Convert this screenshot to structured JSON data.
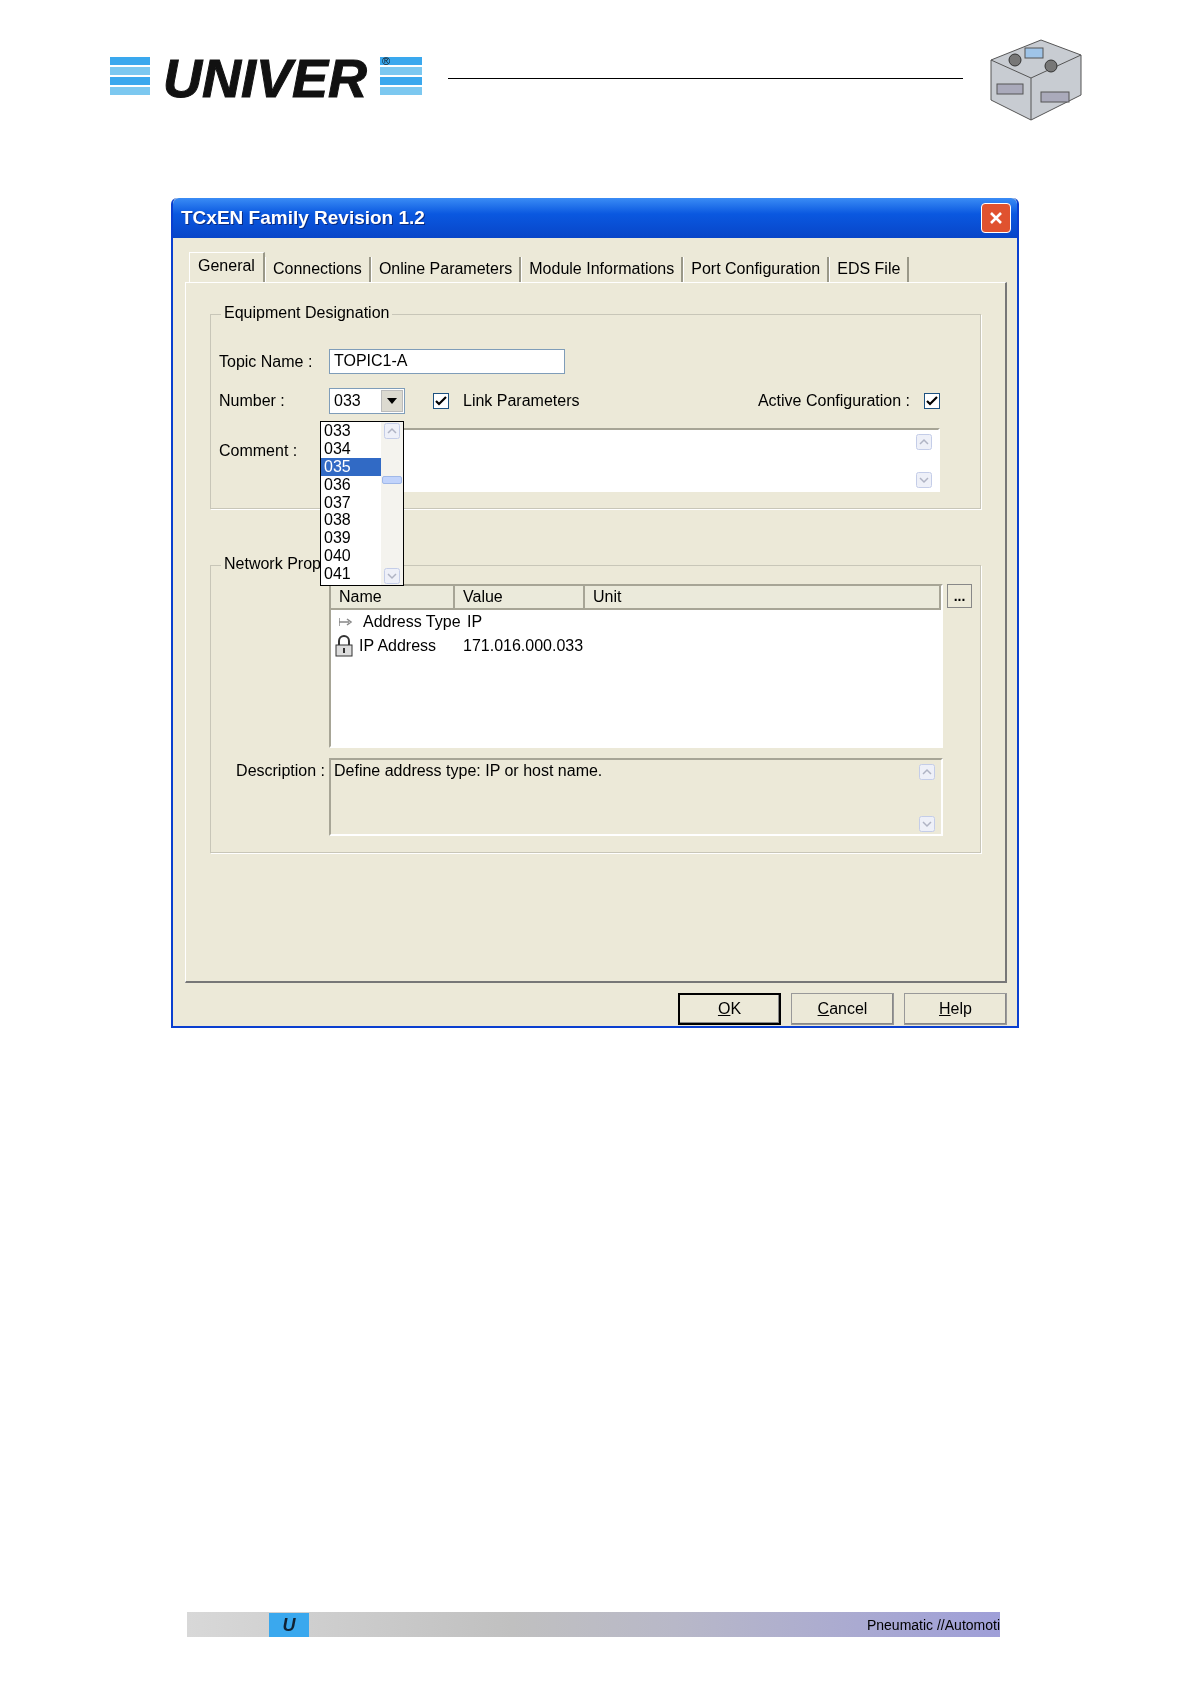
{
  "header": {
    "logo": "UNIVER",
    "logo_mark": "®"
  },
  "dialog": {
    "title": "TCxEN Family Revision 1.2",
    "tabs": [
      {
        "label": "General",
        "selected": true
      },
      {
        "label": "Connections",
        "selected": false
      },
      {
        "label": "Online Parameters",
        "selected": false
      },
      {
        "label": "Module Informations",
        "selected": false
      },
      {
        "label": "Port Configuration",
        "selected": false
      },
      {
        "label": "EDS File",
        "selected": false
      }
    ],
    "equipment": {
      "legend": "Equipment Designation",
      "topic_label": "Topic Name :",
      "topic_value": "TOPIC1-A",
      "number_label": "Number :",
      "number_value": "033",
      "link_parameters": {
        "label": "Link Parameters",
        "checked": true
      },
      "active_configuration": {
        "label": "Active Configuration :",
        "checked": true
      },
      "comment_label": "Comment :",
      "number_list": [
        {
          "label": "033",
          "selected": false
        },
        {
          "label": "034",
          "selected": false
        },
        {
          "label": "035",
          "selected": true
        },
        {
          "label": "036",
          "selected": false
        },
        {
          "label": "037",
          "selected": false
        },
        {
          "label": "038",
          "selected": false
        },
        {
          "label": "039",
          "selected": false
        },
        {
          "label": "040",
          "selected": false
        },
        {
          "label": "041",
          "selected": false
        }
      ]
    },
    "network": {
      "legend": "Network Prop",
      "columns": [
        "Name",
        "Value",
        "Unit"
      ],
      "more_button": "...",
      "rows": [
        {
          "kind": "pointer",
          "name": "Address Type",
          "value": "IP"
        },
        {
          "kind": "locked",
          "name": "IP Address",
          "value": "171.016.000.033"
        }
      ],
      "description_label": "Description :",
      "description": "Define address type: IP or host name."
    },
    "buttons": [
      {
        "label": "OK",
        "default": true
      },
      {
        "label": "Cancel",
        "default": false
      },
      {
        "label": "Help",
        "default": false
      }
    ]
  },
  "footer": {
    "mark": "U",
    "text": "Pneumatic //Automoti"
  }
}
